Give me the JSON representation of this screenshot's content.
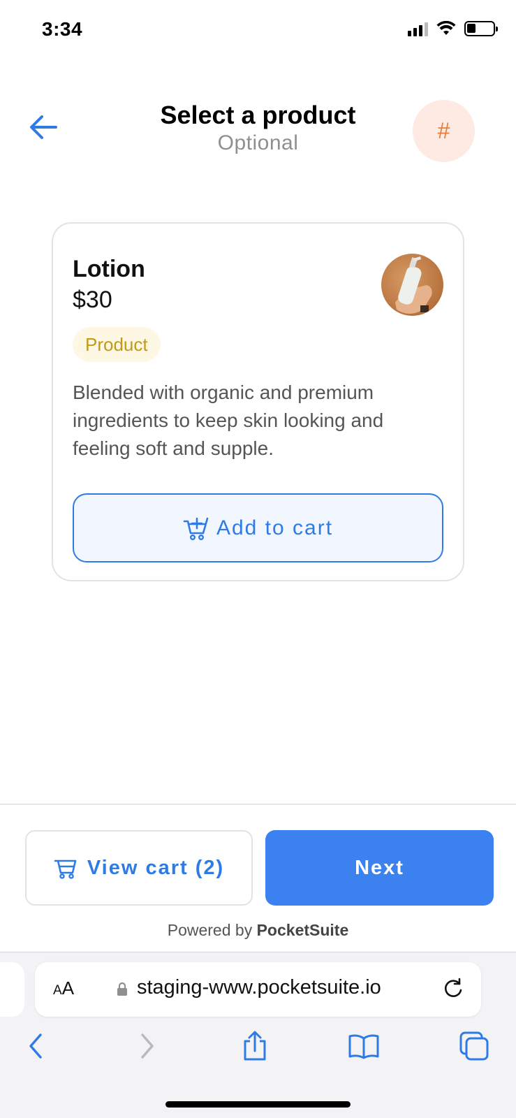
{
  "status_bar": {
    "time": "3:34"
  },
  "header": {
    "title": "Select a product",
    "subtitle": "Optional",
    "hash_label": "#"
  },
  "product": {
    "name": "Lotion",
    "price": "$30",
    "tag": "Product",
    "description": "Blended with organic and premium ingredients to keep skin looking and feeling soft and supple.",
    "add_to_cart_label": "Add to cart"
  },
  "footer": {
    "view_cart_label": "View cart (2)",
    "next_label": "Next",
    "powered_by_prefix": "Powered by",
    "powered_by_brand": "PocketSuite"
  },
  "browser": {
    "aa_small": "A",
    "aa_large": "A",
    "url": "staging-www.pocketsuite.io"
  },
  "colors": {
    "accent": "#3b82f0",
    "link_blue": "#2f7be6",
    "hash_bg": "#fdebe3",
    "hash_fg": "#e97b3c",
    "tag_bg": "#fdf7e3",
    "tag_fg": "#c39a14"
  },
  "icons": {
    "back": "arrow-left-icon",
    "cart_add": "cart-plus-icon",
    "cart": "cart-icon",
    "lock": "lock-icon",
    "reload": "reload-icon",
    "nav_back": "chevron-left-icon",
    "nav_forward": "chevron-right-icon",
    "share": "share-icon",
    "bookmarks": "book-icon",
    "tabs": "tabs-icon"
  }
}
